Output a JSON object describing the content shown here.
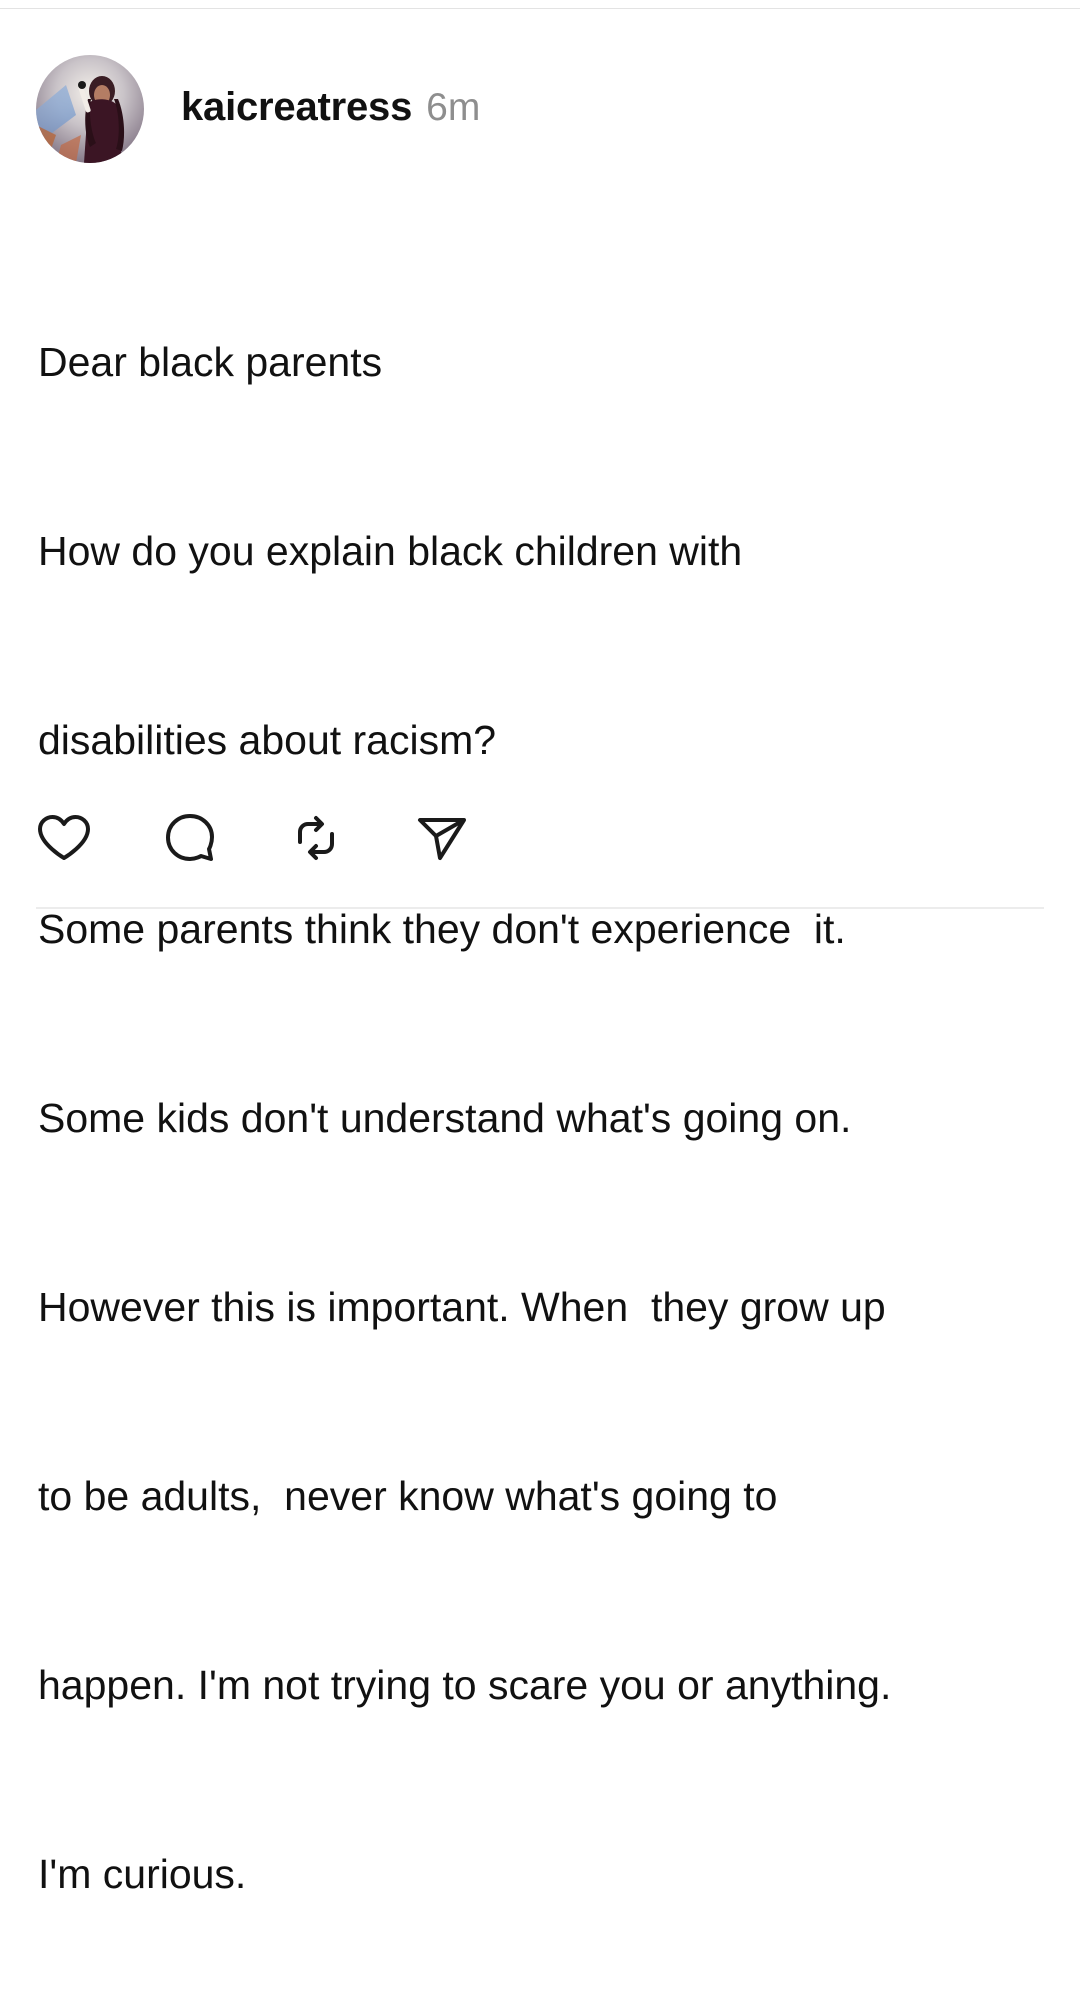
{
  "post": {
    "username": "kaicreatress",
    "timestamp": "6m",
    "body_lines": [
      "Dear black parents",
      "How do you explain black children with",
      "disabilities about racism?",
      "Some parents think they don't experience  it.",
      "Some kids don't understand what's going on.",
      "However this is important. When  they grow up",
      "to be adults,  never know what's going to",
      "happen. I'm not trying to scare you or anything.",
      "I'm curious."
    ]
  },
  "actions": [
    {
      "name": "like",
      "icon": "heart-icon"
    },
    {
      "name": "comment",
      "icon": "comment-bubble-icon"
    },
    {
      "name": "repost",
      "icon": "repost-icon"
    },
    {
      "name": "share",
      "icon": "send-icon"
    }
  ],
  "colors": {
    "text": "#111111",
    "muted": "#8e8e8e",
    "divider": "#ececec",
    "background": "#ffffff"
  }
}
